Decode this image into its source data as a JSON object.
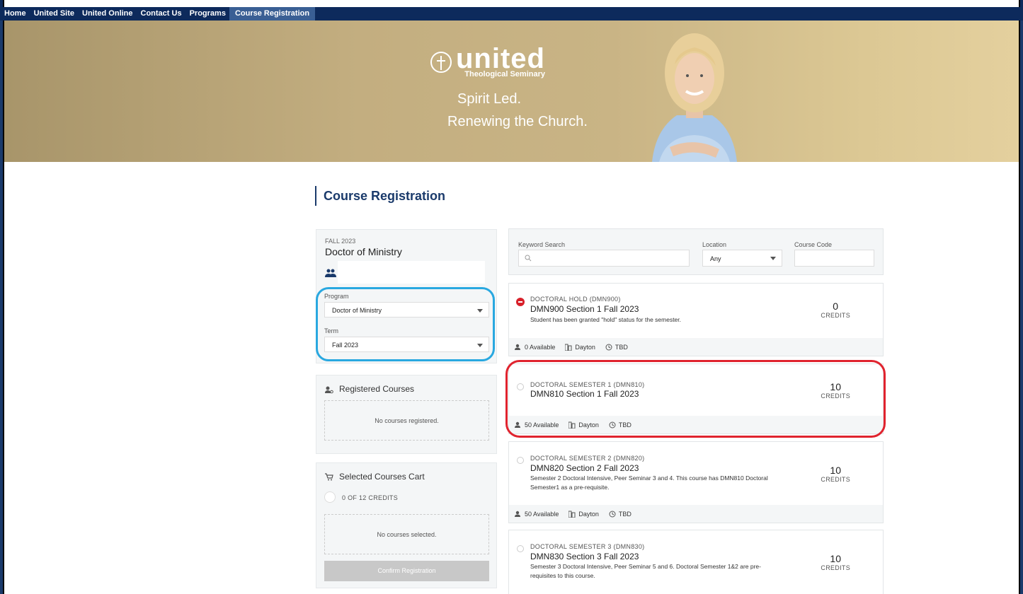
{
  "nav": {
    "items": [
      "Home",
      "United Site",
      "United Online",
      "Contact Us",
      "Programs",
      "Course Registration"
    ]
  },
  "banner": {
    "logo_main": "united",
    "logo_sub": "Theological Seminary",
    "tagline1": "Spirit Led.",
    "tagline2": "Renewing the Church."
  },
  "page": {
    "title": "Course Registration"
  },
  "profile": {
    "term_label": "FALL 2023",
    "program_name": "Doctor of Ministry",
    "program_label": "Program",
    "program_value": "Doctor of Ministry",
    "term_field_label": "Term",
    "term_value": "Fall 2023"
  },
  "registered": {
    "title": "Registered Courses",
    "empty": "No courses registered."
  },
  "cart": {
    "title": "Selected Courses Cart",
    "credits": "0 OF 12 CREDITS",
    "empty": "No courses selected.",
    "confirm": "Confirm Registration"
  },
  "search": {
    "keyword_label": "Keyword Search",
    "location_label": "Location",
    "location_value": "Any",
    "code_label": "Course Code"
  },
  "courses": [
    {
      "code": "DOCTORAL HOLD (DMN900)",
      "title": "DMN900 Section 1 Fall 2023",
      "desc": "Student has been granted \"hold\" status for the semester.",
      "credits": "0",
      "credits_label": "CREDITS",
      "available": "0 Available",
      "location": "Dayton",
      "time": "TBD"
    },
    {
      "code": "DOCTORAL SEMESTER 1 (DMN810)",
      "title": "DMN810 Section 1 Fall 2023",
      "desc": "",
      "credits": "10",
      "credits_label": "CREDITS",
      "available": "50 Available",
      "location": "Dayton",
      "time": "TBD"
    },
    {
      "code": "DOCTORAL SEMESTER 2 (DMN820)",
      "title": "DMN820 Section 2 Fall 2023",
      "desc": "Semester 2 Doctoral Intensive, Peer Seminar 3 and 4. This course has DMN810 Doctoral Semester1 as a pre-requisite.",
      "credits": "10",
      "credits_label": "CREDITS",
      "available": "50 Available",
      "location": "Dayton",
      "time": "TBD"
    },
    {
      "code": "DOCTORAL SEMESTER 3 (DMN830)",
      "title": "DMN830 Section 3 Fall 2023",
      "desc": "Semester 3 Doctoral Intensive, Peer Seminar 5 and 6. Doctoral Semester 1&2 are pre-requisites to this course.",
      "credits": "10",
      "credits_label": "CREDITS"
    }
  ]
}
